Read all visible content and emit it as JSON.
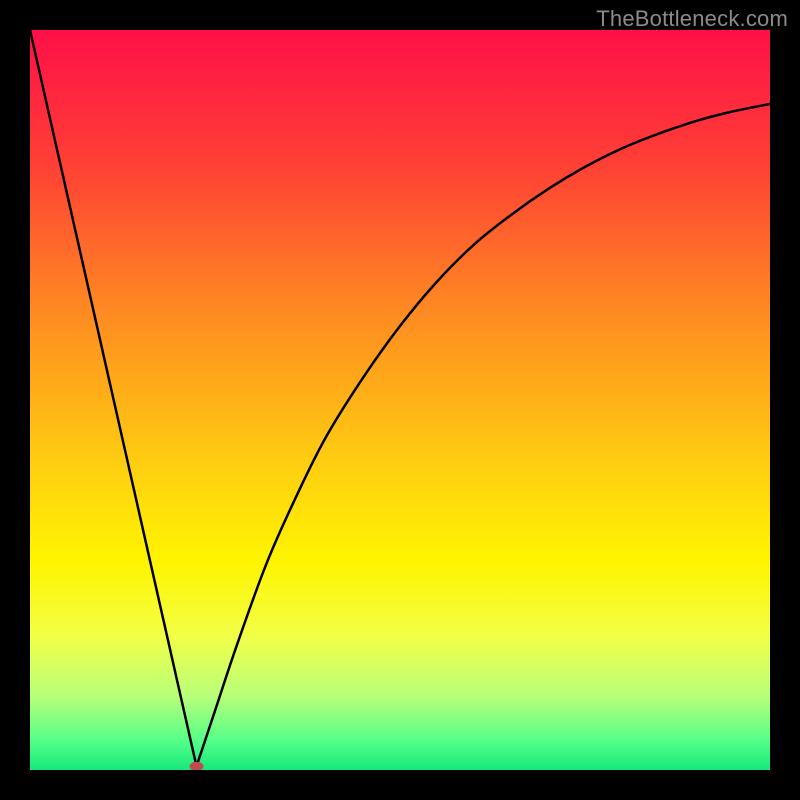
{
  "watermark": "TheBottleneck.com",
  "chart_data": {
    "type": "line",
    "title": "",
    "xlabel": "",
    "ylabel": "",
    "xlim": [
      0,
      100
    ],
    "ylim": [
      0,
      100
    ],
    "gradient_background": {
      "stops": [
        {
          "pos": 0.0,
          "color": "#ff1048"
        },
        {
          "pos": 0.18,
          "color": "#ff3f35"
        },
        {
          "pos": 0.38,
          "color": "#ff8a22"
        },
        {
          "pos": 0.58,
          "color": "#ffcc11"
        },
        {
          "pos": 0.72,
          "color": "#fff500"
        },
        {
          "pos": 0.82,
          "color": "#f2ff47"
        },
        {
          "pos": 0.9,
          "color": "#b8ff7a"
        },
        {
          "pos": 0.96,
          "color": "#55ff88"
        },
        {
          "pos": 1.0,
          "color": "#17e87a"
        }
      ]
    },
    "series": [
      {
        "name": "left-segment",
        "x": [
          0,
          22.5
        ],
        "y": [
          100,
          0.5
        ]
      },
      {
        "name": "right-segment",
        "x": [
          22.5,
          25,
          28,
          32,
          36,
          40,
          45,
          50,
          55,
          60,
          65,
          70,
          75,
          80,
          85,
          90,
          95,
          100
        ],
        "y": [
          0.5,
          8,
          17,
          28,
          37,
          45,
          53,
          60,
          66,
          71,
          75,
          78.5,
          81.5,
          84,
          86,
          87.7,
          89,
          90
        ]
      }
    ],
    "marker": {
      "name": "dip-marker",
      "x": 22.5,
      "y": 0.5,
      "color": "#c14b4b",
      "rx": 7,
      "ry": 4.5
    }
  }
}
